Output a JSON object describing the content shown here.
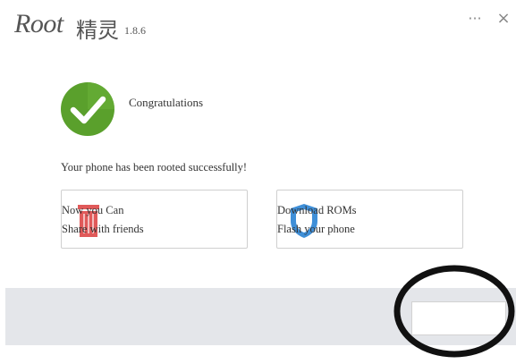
{
  "app": {
    "logo_text": "Root",
    "logo_cn": "精灵",
    "version": "1.8.6"
  },
  "window_controls": {
    "menu_label": "···",
    "close_label": "×"
  },
  "status": {
    "title": "Congratulations",
    "message": "Your phone has been rooted successfully!",
    "icon": "check-circle-icon",
    "icon_color": "#5aa02c"
  },
  "cards": [
    {
      "line1": "Now you Can",
      "line2": "Share with friends",
      "icon": "trash-icon",
      "icon_color": "#e05a5a"
    },
    {
      "line1": "Download ROMs",
      "line2": "Flash your phone",
      "icon": "shield-icon",
      "icon_color": "#3f8fd8"
    }
  ],
  "footer": {
    "button_label": ""
  }
}
